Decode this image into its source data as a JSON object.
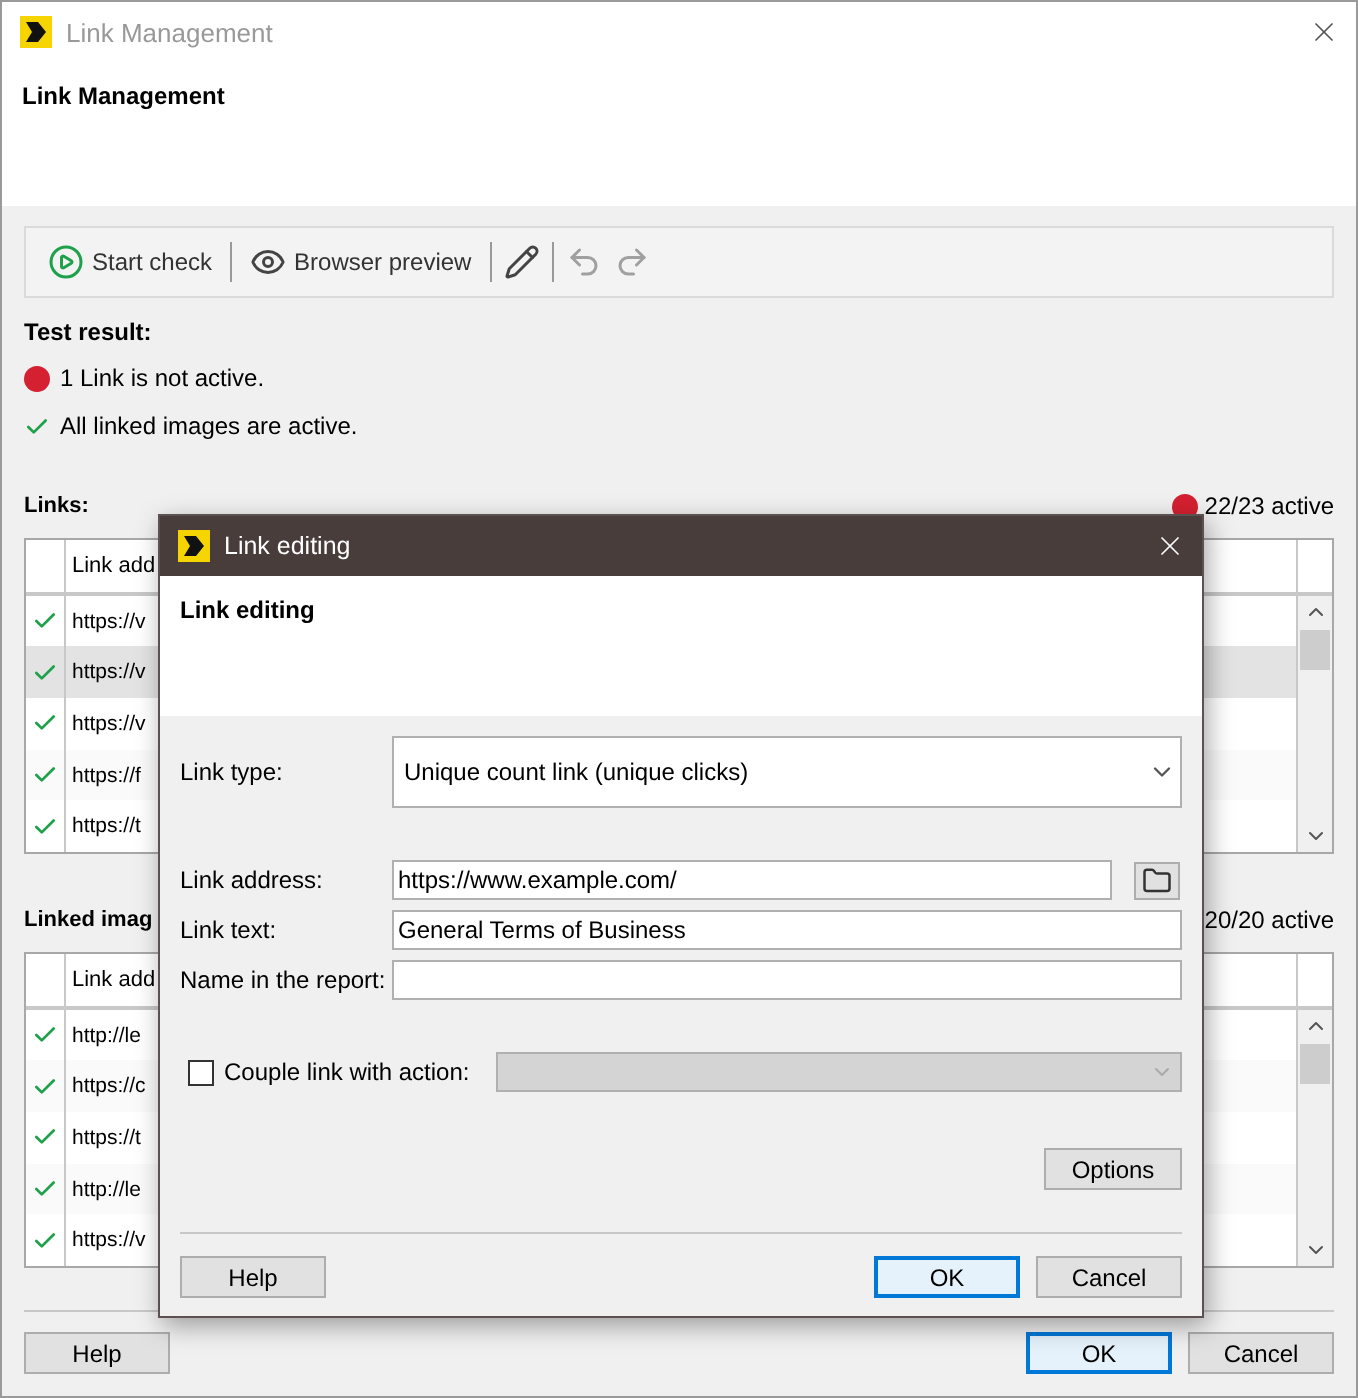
{
  "window": {
    "title": "Link Management",
    "heading": "Link Management"
  },
  "toolbar": [
    {
      "kind": "button",
      "label": "Start check",
      "disabled": false
    },
    {
      "kind": "separator"
    },
    {
      "kind": "button",
      "label": "Browser preview",
      "disabled": false
    },
    {
      "kind": "separator"
    },
    {
      "kind": "icon",
      "disabled": false
    },
    {
      "kind": "separator"
    },
    {
      "kind": "icon",
      "disabled": true
    },
    {
      "kind": "icon",
      "disabled": true
    }
  ],
  "test_result": {
    "label": "Test result:",
    "items": [
      {
        "active": false,
        "text": "1 Link is not active."
      },
      {
        "active": true,
        "text": "All linked images are active."
      }
    ]
  },
  "links": {
    "label": "Links:",
    "summary": "22/23 active",
    "active": false,
    "columns": [
      "Link add"
    ],
    "rows": [
      {
        "active": true,
        "address": "https://v",
        "selected": false
      },
      {
        "active": true,
        "address": "https://v",
        "selected": true
      },
      {
        "active": true,
        "address": "https://v",
        "selected": false
      },
      {
        "active": true,
        "address": "https://f",
        "selected": false
      },
      {
        "active": true,
        "address": "https://t",
        "selected": false
      }
    ]
  },
  "linked_images": {
    "label": "Linked imag",
    "summary": "20/20 active",
    "columns": [
      "Link add"
    ],
    "rows": [
      {
        "active": true,
        "address": "http://le",
        "selected": false
      },
      {
        "active": true,
        "address": "https://c",
        "selected": false
      },
      {
        "active": true,
        "address": "https://t",
        "selected": false
      },
      {
        "active": true,
        "address": "http://le",
        "selected": false
      },
      {
        "active": true,
        "address": "https://v",
        "selected": false
      }
    ]
  },
  "buttons": [
    {
      "label": "Help",
      "default": false
    },
    {
      "label": "OK",
      "default": true
    },
    {
      "label": "Cancel",
      "default": false
    }
  ],
  "dialog": {
    "title": "Link editing",
    "heading": "Link editing",
    "link_type": {
      "label": "Link type:",
      "value": "Unique count link (unique clicks)"
    },
    "link_address": {
      "label": "Link address:",
      "value": "https://www.example.com/"
    },
    "link_text": {
      "label": "Link text:",
      "value": "General Terms of Business"
    },
    "report_name": {
      "label": "Name in the report:"
    },
    "couple": {
      "label": "Couple link with action:",
      "checked": false,
      "disabled": true
    },
    "options_button": "Options",
    "buttons": [
      {
        "label": "Help",
        "default": false
      },
      {
        "label": "OK",
        "default": true
      },
      {
        "label": "Cancel",
        "default": false
      }
    ]
  }
}
